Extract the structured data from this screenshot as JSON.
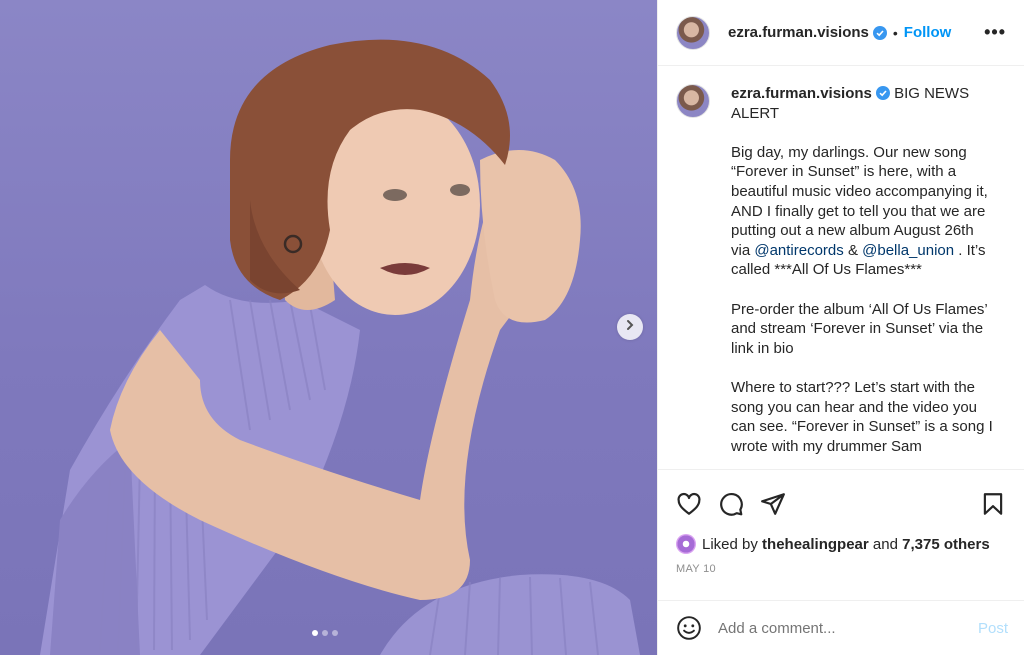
{
  "post": {
    "author": "ezra.furman.visions",
    "separator": "•",
    "follow_label": "Follow",
    "more_label": "•••",
    "caption_headline": "BIG NEWS ALERT",
    "caption_p1_a": "Big day, my darlings. Our new song “Forever in Sunset” is here, with a beautiful music video accompanying it, AND I finally get to tell you that we are putting out a new album August 26th via ",
    "mention_1": "@antirecords",
    "caption_p1_b": " & ",
    "mention_2": "@bella_union",
    "caption_p1_c": " . It’s called ***All Of Us Flames***",
    "caption_p2": "Pre-order the album ‘All Of Us Flames’ and stream ‘Forever in Sunset’ via the link in bio",
    "caption_p3": "Where to start??? Let’s start with the song you can hear and the video you can see. “Forever in Sunset” is a song I wrote with my drummer Sam",
    "liked_by_prefix": "Liked by",
    "liked_by_user": "thehealingpear",
    "liked_by_and": "and",
    "likes_others": "7,375 others",
    "date": "MAY 10",
    "comment_placeholder": "Add a comment...",
    "post_label": "Post"
  },
  "carousel": {
    "count": 3,
    "active_index": 0
  },
  "icons": {
    "verified": "verified-badge-icon",
    "like": "heart-icon",
    "comment": "comment-bubble-icon",
    "share": "paper-plane-icon",
    "save": "bookmark-icon",
    "emoji": "smiley-icon",
    "next": "chevron-right-icon"
  },
  "colors": {
    "accent": "#0095f6",
    "verified": "#3897f0",
    "media_background": "#8b86c6",
    "mention": "#00376b",
    "muted": "#8e8e8e",
    "post_disabled": "#b2dffc"
  }
}
